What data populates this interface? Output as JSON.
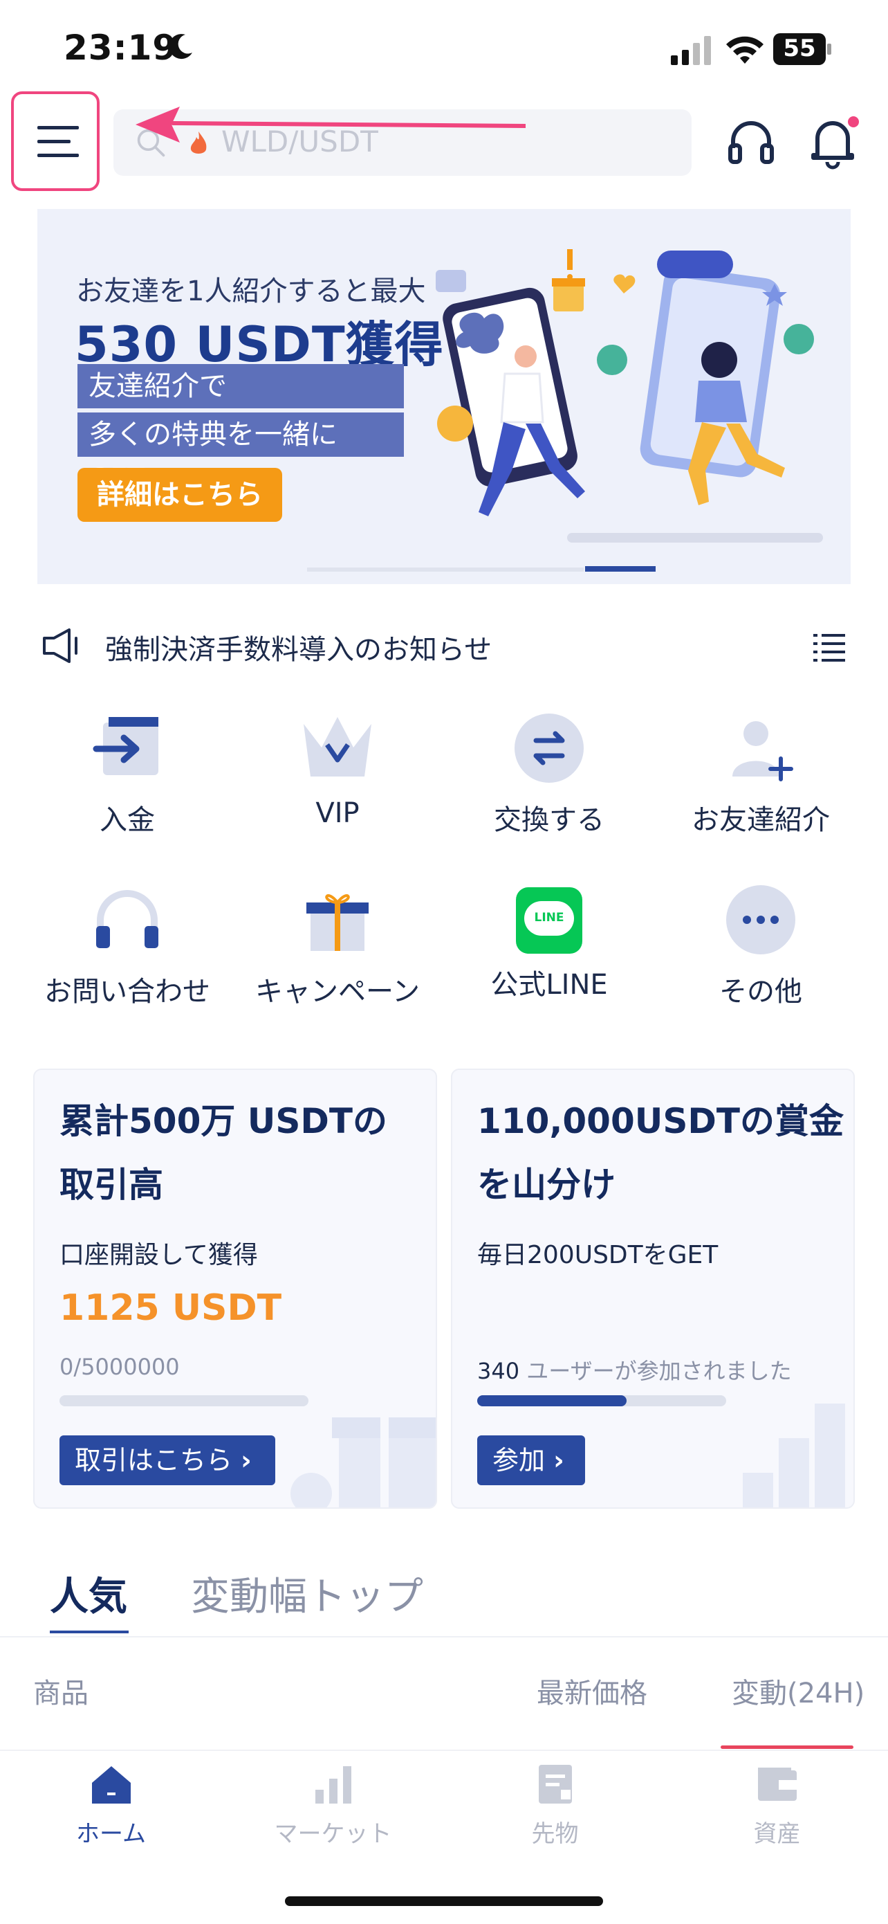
{
  "status_bar": {
    "time": "23:19",
    "battery": "55"
  },
  "header": {
    "search_placeholder": "WLD/USDT"
  },
  "banner": {
    "line1": "お友達を1人紹介すると最大",
    "line2": "530 USDT獲得",
    "line3": "友達紹介で",
    "line4": "多くの特典を一緒にGET",
    "button": "詳細はこちら"
  },
  "notice": {
    "text": "強制決済手数料導入のお知らせ"
  },
  "quick_grid": [
    {
      "label": "入金",
      "icon": "deposit-icon"
    },
    {
      "label": "VIP",
      "icon": "vip-crown-icon"
    },
    {
      "label": "交換する",
      "icon": "exchange-icon"
    },
    {
      "label": "お友達紹介",
      "icon": "invite-friend-icon"
    },
    {
      "label": "お問い合わせ",
      "icon": "support-headset-icon"
    },
    {
      "label": "キャンペーン",
      "icon": "gift-icon"
    },
    {
      "label": "公式LINE",
      "icon": "line-icon"
    },
    {
      "label": "その他",
      "icon": "more-icon"
    }
  ],
  "line_icon_text": "LINE",
  "cards": [
    {
      "title_l1": "累計500万 USDTの",
      "title_l2": "取引高",
      "subtitle": "口座開設して獲得",
      "amount": "1125 USDT",
      "progress_text": "0/5000000",
      "progress": 0.0,
      "button": "取引はこちら"
    },
    {
      "title_l1": "110,000USDTの賞金",
      "title_l2": "を山分け",
      "subtitle": "毎日200USDTをGET",
      "participants_count": "340",
      "participants_suffix": " ユーザーが参加されました",
      "progress": 0.6,
      "button": "参加"
    }
  ],
  "tabs": {
    "active": "人気",
    "inactive": "変動幅トップ"
  },
  "table_header": {
    "product": "商品",
    "price": "最新価格",
    "change": "変動(24H)"
  },
  "bottom_nav": [
    {
      "label": "ホーム",
      "icon": "home-icon",
      "active": true
    },
    {
      "label": "マーケット",
      "icon": "market-icon",
      "active": false
    },
    {
      "label": "先物",
      "icon": "futures-icon",
      "active": false
    },
    {
      "label": "資産",
      "icon": "wallet-icon",
      "active": false
    }
  ],
  "colors": {
    "brand": "#2a4aa0",
    "accent_orange": "#f5922a",
    "annotation": "#f0457f"
  }
}
